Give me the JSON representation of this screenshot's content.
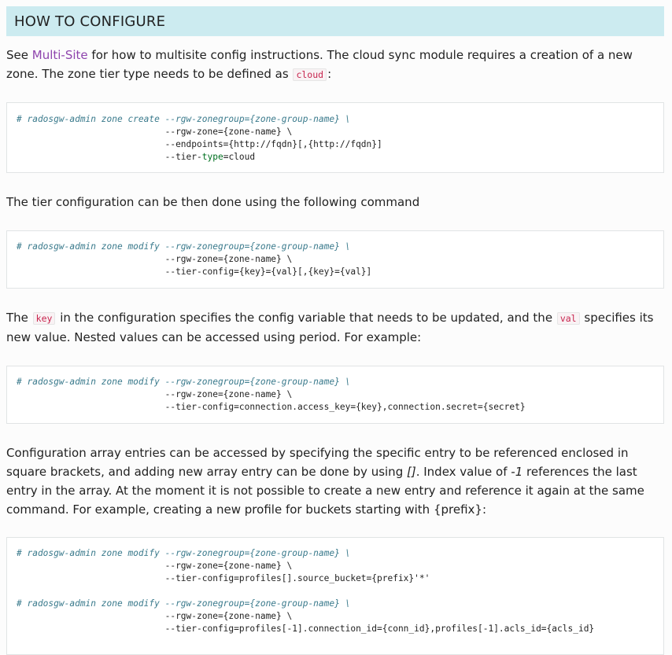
{
  "heading": "HOW TO CONFIGURE",
  "intro": {
    "see": "See ",
    "link": "Multi-Site",
    "rest": " for how to multisite config instructions. The cloud sync module requires a creation of a new zone. The zone tier type needs to be defined as ",
    "code": "cloud",
    "end": ":"
  },
  "code1": {
    "comment": "# radosgw-admin zone create --rgw-zonegroup={zone-group-name} \\",
    "line2": "                            --rgw-zone={zone-name} \\",
    "line3": "                            --endpoints={http://fqdn}[,{http://fqdn}]",
    "line4_pre": "                            --tier-",
    "line4_kw": "type",
    "line4_post": "=cloud"
  },
  "para2": "The tier configuration can be then done using the following command",
  "code2": {
    "comment": "# radosgw-admin zone modify --rgw-zonegroup={zone-group-name} \\",
    "line2": "                            --rgw-zone={zone-name} \\",
    "line3": "                            --tier-config={key}={val}[,{key}={val}]"
  },
  "para3": {
    "a": "The ",
    "code_key": "key",
    "b": " in the configuration specifies the config variable that needs to be updated, and the ",
    "code_val": "val",
    "c": " specifies its new value. Nested values can be accessed using period. For example:"
  },
  "code3": {
    "comment": "# radosgw-admin zone modify --rgw-zonegroup={zone-group-name} \\",
    "line2": "                            --rgw-zone={zone-name} \\",
    "line3": "                            --tier-config=connection.access_key={key},connection.secret={secret}"
  },
  "para4": {
    "a": "Configuration array entries can be accessed by specifying the specific entry to be referenced enclosed in square brackets, and adding new array entry can be done by using ",
    "em1": "[]",
    "b": ". Index value of ",
    "em2": "-1",
    "c": " references the last entry in the array. At the moment it is not possible to create a new entry and reference it again at the same command. For example, creating a new profile for buckets starting with {prefix}:"
  },
  "code4": {
    "comment1": "# radosgw-admin zone modify --rgw-zonegroup={zone-group-name} \\",
    "line2": "                            --rgw-zone={zone-name} \\",
    "line3": "                            --tier-config=profiles[].source_bucket={prefix}'*'",
    "comment2": "# radosgw-admin zone modify --rgw-zonegroup={zone-group-name} \\",
    "line5": "                            --rgw-zone={zone-name} \\",
    "line6": "                            --tier-config=profiles[-1].connection_id={conn_id},profiles[-1].acls_id={acls_id}"
  }
}
